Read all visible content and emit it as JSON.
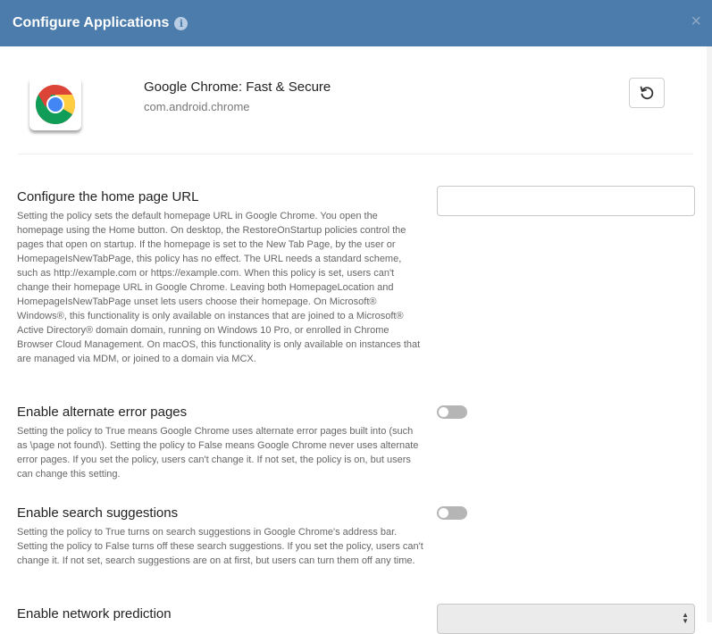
{
  "header": {
    "title": "Configure Applications",
    "info_glyph": "i",
    "close_glyph": "×"
  },
  "app": {
    "name": "Google Chrome: Fast & Secure",
    "package": "com.android.chrome",
    "icon": "chrome-logo-icon"
  },
  "toolbar": {
    "reset_icon": "reset-icon"
  },
  "settings": [
    {
      "title": "Configure the home page URL",
      "description": "Setting the policy sets the default homepage URL in Google Chrome. You open the homepage using the Home button. On desktop, the RestoreOnStartup policies control the pages that open on startup. If the homepage is set to the New Tab Page, by the user or HomepageIsNewTabPage, this policy has no effect. The URL needs a standard scheme, such as http://example.com or https://example.com. When this policy is set, users can't change their homepage URL in Google Chrome. Leaving both HomepageLocation and HomepageIsNewTabPage unset lets users choose their homepage. On Microsoft® Windows®, this functionality is only available on instances that are joined to a Microsoft® Active Directory® domain domain, running on Windows 10 Pro, or enrolled in Chrome Browser Cloud Management. On macOS, this functionality is only available on instances that are managed via MDM, or joined to a domain via MCX.",
      "control": "text",
      "value": "",
      "placeholder": ""
    },
    {
      "title": "Enable alternate error pages",
      "description": "Setting the policy to True means Google Chrome uses alternate error pages built into (such as \\page not found\\). Setting the policy to False means Google Chrome never uses alternate error pages. If you set the policy, users can't change it. If not set, the policy is on, but users can change this setting.",
      "control": "toggle",
      "enabled": false
    },
    {
      "title": "Enable search suggestions",
      "description": "Setting the policy to True turns on search suggestions in Google Chrome's address bar. Setting the policy to False turns off these search suggestions. If you set the policy, users can't change it. If not set, search suggestions are on at first, but users can turn them off any time.",
      "control": "toggle",
      "enabled": false
    },
    {
      "title": "Enable network prediction",
      "description": "",
      "control": "select",
      "value": ""
    }
  ],
  "colors": {
    "header_bg": "#4b7cab",
    "toggle_off": "#b5b5b5"
  }
}
